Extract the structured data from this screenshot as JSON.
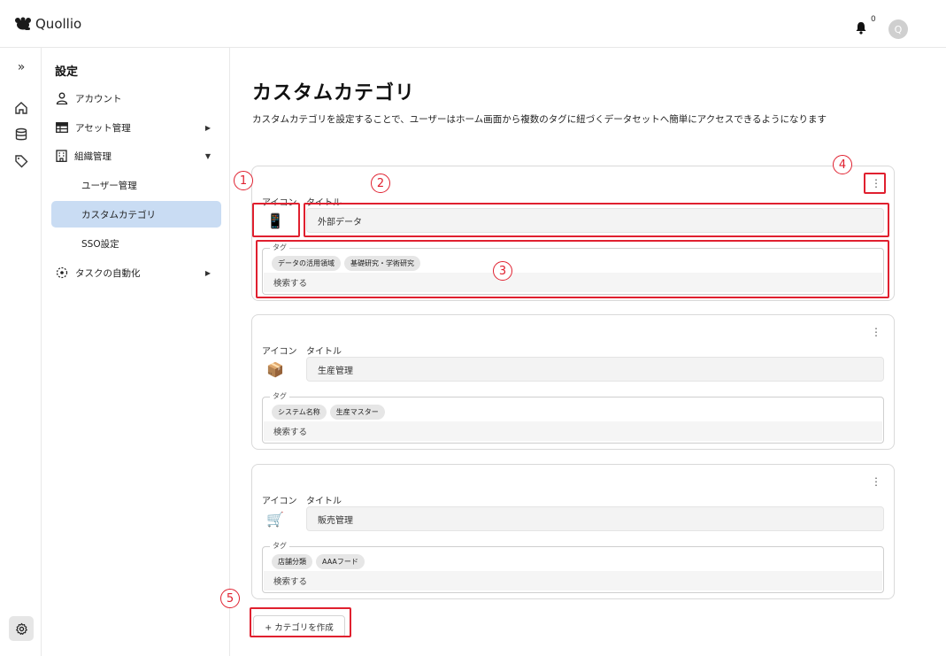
{
  "header": {
    "brand": "Quollio",
    "notification_count": "0",
    "avatar_initial": "Q"
  },
  "rail": {
    "expand_label": "»"
  },
  "menu": {
    "title": "設定",
    "account": "アカウント",
    "asset_management": "アセット管理",
    "org_management": "組織管理",
    "user_management": "ユーザー管理",
    "custom_category": "カスタムカテゴリ",
    "sso": "SSO設定",
    "task_automation": "タスクの自動化"
  },
  "main": {
    "title": "カスタムカテゴリ",
    "description": "カスタムカテゴリを設定することで、ユーザーはホーム画面から複数のタグに紐づくデータセットへ簡単にアクセスできるようになります",
    "create_button": "+ カテゴリを作成"
  },
  "cards": [
    {
      "icon_label": "アイコン",
      "title_label": "タイトル",
      "icon": "📱",
      "title": "外部データ",
      "tag_label": "タグ",
      "tags": [
        "データの活用領域",
        "基礎研究・学術研究"
      ],
      "search_placeholder": "検索する"
    },
    {
      "icon_label": "アイコン",
      "title_label": "タイトル",
      "icon": "📦",
      "title": "生産管理",
      "tag_label": "タグ",
      "tags": [
        "システム名称",
        "生産マスター"
      ],
      "search_placeholder": "検索する"
    },
    {
      "icon_label": "アイコン",
      "title_label": "タイトル",
      "icon": "🛒",
      "title": "販売管理",
      "tag_label": "タグ",
      "tags": [
        "店舗分類",
        "AAAフード"
      ],
      "search_placeholder": "検索する"
    }
  ],
  "annotations": {
    "n1": "1",
    "n2": "2",
    "n3": "3",
    "n4": "4",
    "n5": "5"
  },
  "colors": {
    "annotation_red": "#e0202f",
    "active_menu_bg": "#c9dcf3"
  }
}
